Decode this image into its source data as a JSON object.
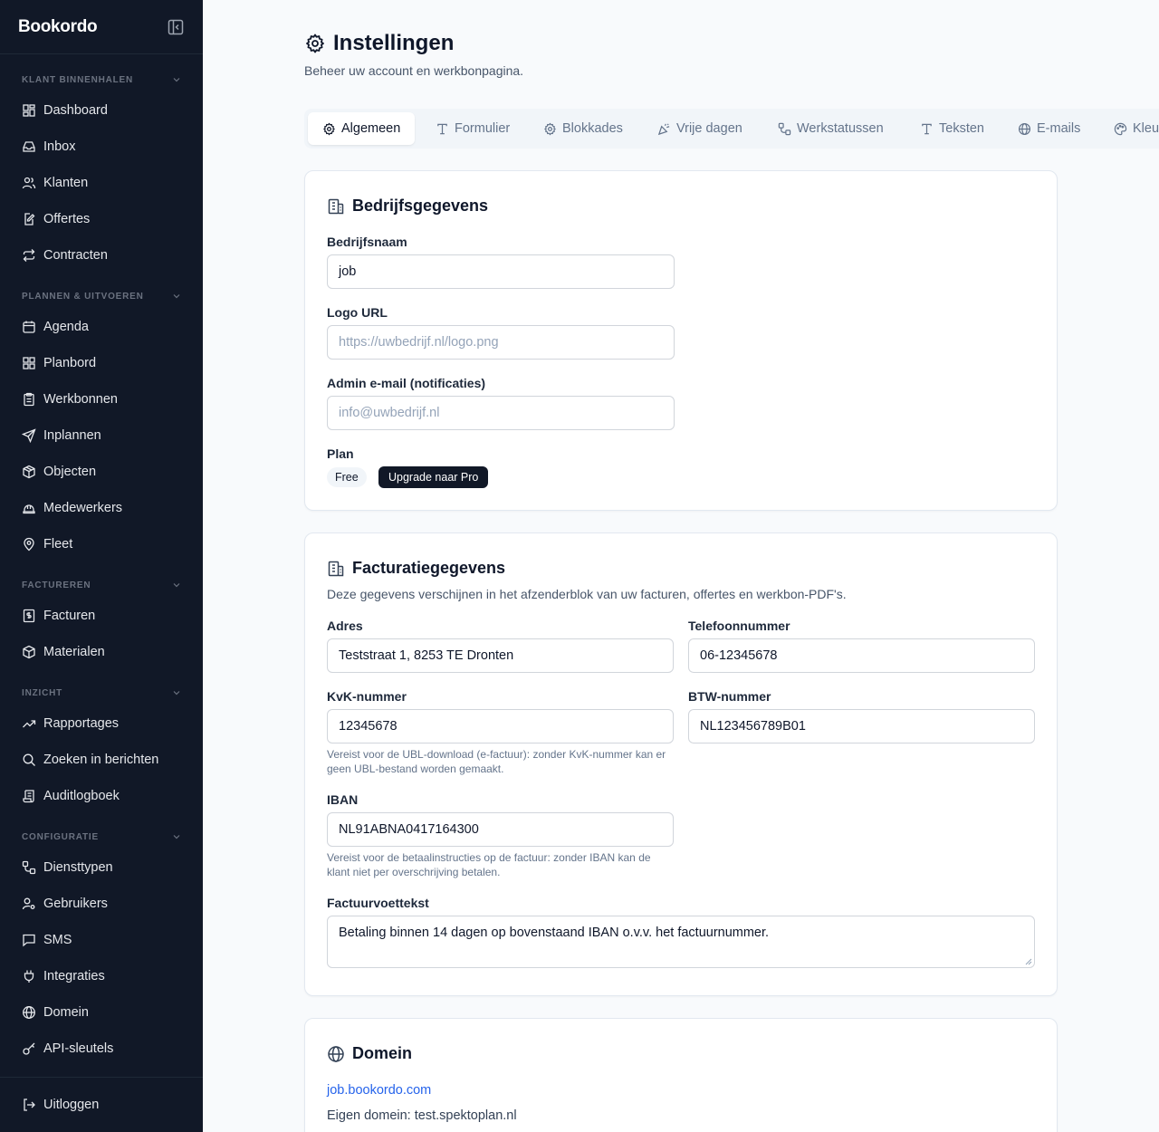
{
  "sidebar": {
    "brand": "Bookordo",
    "sections": [
      {
        "title": "KLANT BINNENHALEN",
        "items": [
          {
            "label": "Dashboard",
            "icon": "dashboard-icon"
          },
          {
            "label": "Inbox",
            "icon": "inbox-icon"
          },
          {
            "label": "Klanten",
            "icon": "users-icon"
          },
          {
            "label": "Offertes",
            "icon": "file-edit-icon"
          },
          {
            "label": "Contracten",
            "icon": "repeat-icon"
          }
        ]
      },
      {
        "title": "PLANNEN & UITVOEREN",
        "items": [
          {
            "label": "Agenda",
            "icon": "calendar-icon"
          },
          {
            "label": "Planbord",
            "icon": "grid-icon"
          },
          {
            "label": "Werkbonnen",
            "icon": "clipboard-icon"
          },
          {
            "label": "Inplannen",
            "icon": "send-icon"
          },
          {
            "label": "Objecten",
            "icon": "package-icon"
          },
          {
            "label": "Medewerkers",
            "icon": "hardhat-icon"
          },
          {
            "label": "Fleet",
            "icon": "map-pin-icon"
          }
        ]
      },
      {
        "title": "FACTUREREN",
        "items": [
          {
            "label": "Facturen",
            "icon": "invoice-icon"
          },
          {
            "label": "Materialen",
            "icon": "box-icon"
          }
        ]
      },
      {
        "title": "INZICHT",
        "items": [
          {
            "label": "Rapportages",
            "icon": "trending-up-icon"
          },
          {
            "label": "Zoeken in berichten",
            "icon": "search-icon"
          },
          {
            "label": "Auditlogboek",
            "icon": "scroll-icon"
          }
        ]
      },
      {
        "title": "CONFIGURATIE",
        "items": [
          {
            "label": "Diensttypen",
            "icon": "workflow-icon"
          },
          {
            "label": "Gebruikers",
            "icon": "user-cog-icon"
          },
          {
            "label": "SMS",
            "icon": "message-icon"
          },
          {
            "label": "Integraties",
            "icon": "plug-icon"
          },
          {
            "label": "Domein",
            "icon": "globe-icon"
          },
          {
            "label": "API-sleutels",
            "icon": "key-icon"
          }
        ]
      }
    ],
    "logout": "Uitloggen"
  },
  "header": {
    "title": "Instellingen",
    "subtitle": "Beheer uw account en werkbonpagina."
  },
  "tabs": [
    {
      "label": "Algemeen",
      "active": true,
      "icon": "gear-icon"
    },
    {
      "label": "Formulier",
      "icon": "type-icon"
    },
    {
      "label": "Blokkades",
      "icon": "gear-icon"
    },
    {
      "label": "Vrije dagen",
      "icon": "party-icon"
    },
    {
      "label": "Werkstatussen",
      "icon": "workflow-icon"
    },
    {
      "label": "Teksten",
      "icon": "type-icon"
    },
    {
      "label": "E-mails",
      "icon": "globe-icon"
    },
    {
      "label": "Kleu",
      "icon": "palette-icon"
    }
  ],
  "company": {
    "title": "Bedrijfsgegevens",
    "name_label": "Bedrijfsnaam",
    "name_value": "job",
    "logo_label": "Logo URL",
    "logo_placeholder": "https://uwbedrijf.nl/logo.png",
    "email_label": "Admin e-mail (notificaties)",
    "email_placeholder": "info@uwbedrijf.nl",
    "plan_label": "Plan",
    "plan_badge": "Free",
    "upgrade_button": "Upgrade naar Pro"
  },
  "billing": {
    "title": "Facturatiegegevens",
    "description": "Deze gegevens verschijnen in het afzenderblok van uw facturen, offertes en werkbon-PDF's.",
    "address_label": "Adres",
    "address_value": "Teststraat 1, 8253 TE Dronten",
    "phone_label": "Telefoonnummer",
    "phone_value": "06-12345678",
    "kvk_label": "KvK-nummer",
    "kvk_value": "12345678",
    "kvk_help": "Vereist voor de UBL-download (e-factuur): zonder KvK-nummer kan er geen UBL-bestand worden gemaakt.",
    "btw_label": "BTW-nummer",
    "btw_value": "NL123456789B01",
    "iban_label": "IBAN",
    "iban_value": "NL91ABNA0417164300",
    "iban_help": "Vereist voor de betaalinstructies op de factuur: zonder IBAN kan de klant niet per overschrijving betalen.",
    "footer_label": "Factuurvoettekst",
    "footer_value": "Betaling binnen 14 dagen op bovenstaand IBAN o.v.v. het factuurnummer."
  },
  "domain": {
    "title": "Domein",
    "link": "job.bookordo.com",
    "custom": "Eigen domein: test.spektoplan.nl"
  }
}
